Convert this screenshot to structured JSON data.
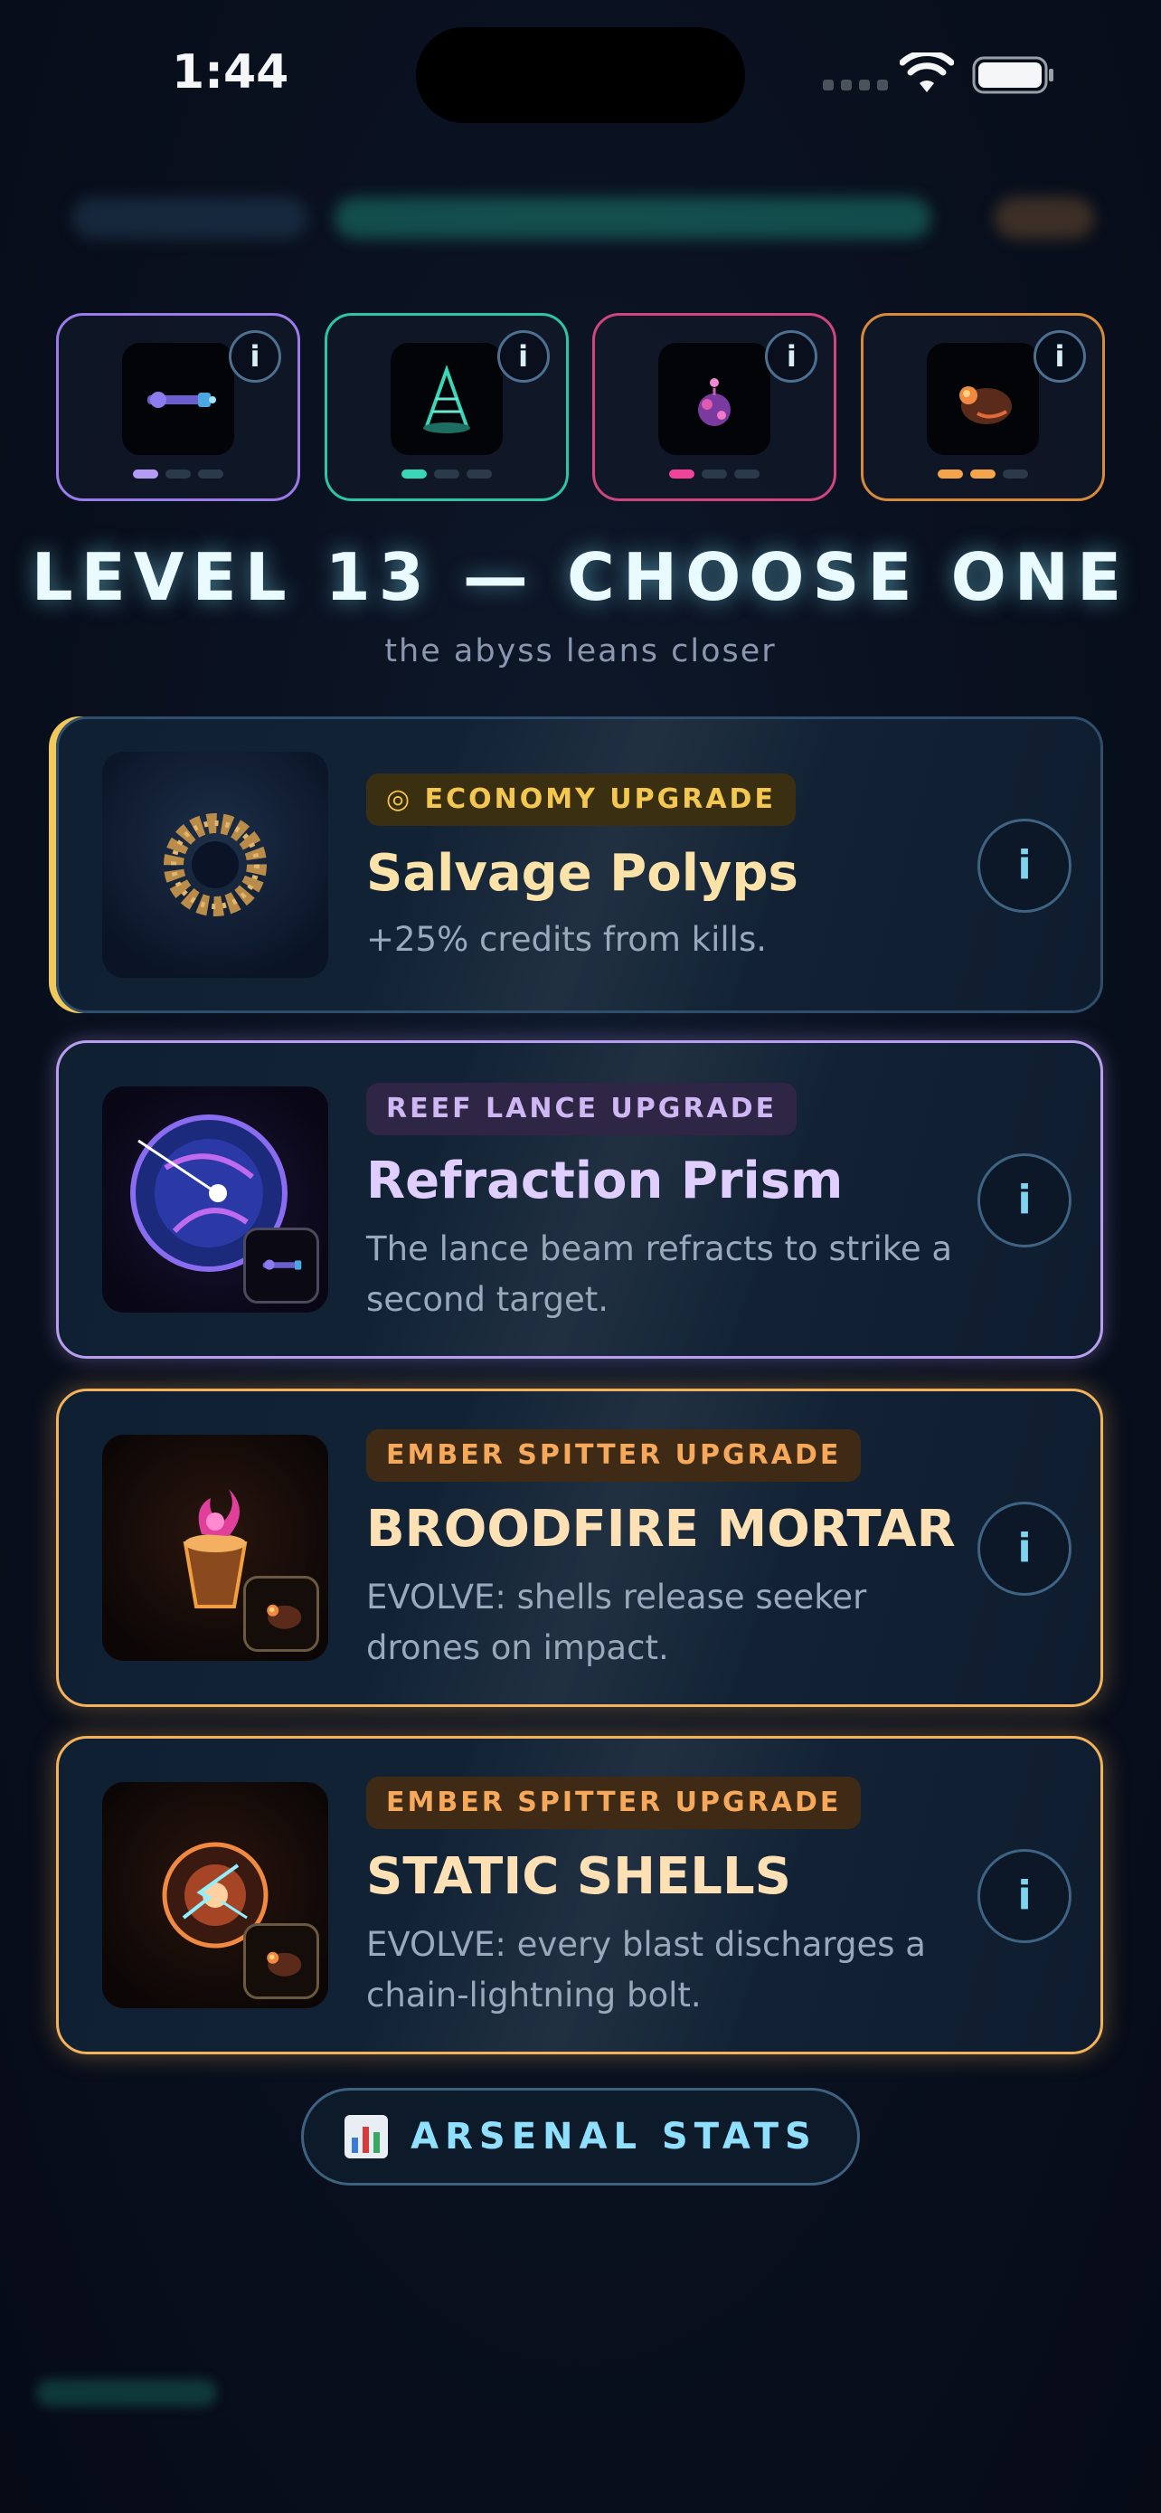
{
  "status_bar": {
    "time": "1:44"
  },
  "slots": [
    {
      "color": "#9b7bea",
      "pips": [
        1,
        0,
        0
      ]
    },
    {
      "color": "#2cc6a4",
      "pips": [
        1,
        0,
        0
      ]
    },
    {
      "color": "#d0457f",
      "pips": [
        1,
        0,
        0
      ]
    },
    {
      "color": "#d68a3a",
      "pips": [
        1,
        1,
        0
      ]
    }
  ],
  "slot_info_label": "i",
  "heading": {
    "title": "LEVEL 13 — CHOOSE ONE",
    "subtitle": "the abyss leans closer"
  },
  "cards": [
    {
      "badge": "◎ ECONOMY UPGRADE",
      "name": "Salvage Polyps",
      "desc": "+25% credits from kills.",
      "info": "i"
    },
    {
      "badge": "REEF LANCE UPGRADE",
      "name": "Refraction Prism",
      "desc": "The lance beam refracts to strike a second target.",
      "info": "i"
    },
    {
      "badge": "EMBER SPITTER UPGRADE",
      "name": "BROODFIRE MORTAR",
      "desc": "EVOLVE: shells release seeker drones on impact.",
      "info": "i"
    },
    {
      "badge": "EMBER SPITTER UPGRADE",
      "name": "STATIC SHELLS",
      "desc": "EVOLVE: every blast discharges a chain-lightning bolt.",
      "info": "i"
    }
  ],
  "stats_button": {
    "icon": "bar-chart-icon",
    "label": "ARSENAL STATS"
  }
}
